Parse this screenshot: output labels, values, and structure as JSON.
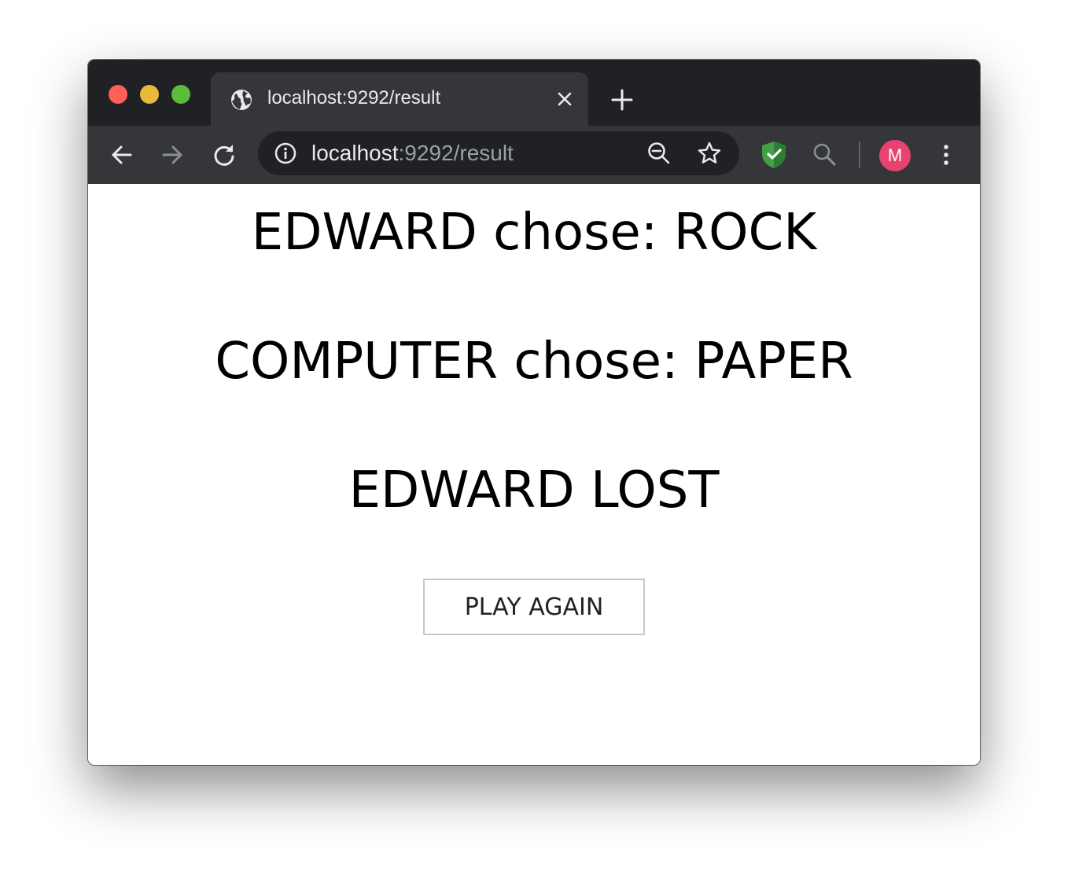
{
  "browser": {
    "tab": {
      "title": "localhost:9292/result",
      "close_icon": "close-icon",
      "favicon": "globe-icon"
    },
    "new_tab_icon": "plus-icon",
    "address_bar": {
      "host": "localhost",
      "path": ":9292/result",
      "info_icon": "info-icon"
    },
    "toolbar_icons": [
      "back-arrow-icon",
      "forward-arrow-icon",
      "reload-icon",
      "zoom-out-icon",
      "star-icon",
      "shield-check-icon",
      "search-icon",
      "more-vert-icon"
    ],
    "profile": {
      "initial": "M",
      "color": "#e8436f"
    }
  },
  "result": {
    "player_choice": "EDWARD chose: ROCK",
    "computer_choice": "COMPUTER chose: PAPER",
    "outcome": "EDWARD LOST",
    "play_again_label": "PLAY AGAIN"
  }
}
